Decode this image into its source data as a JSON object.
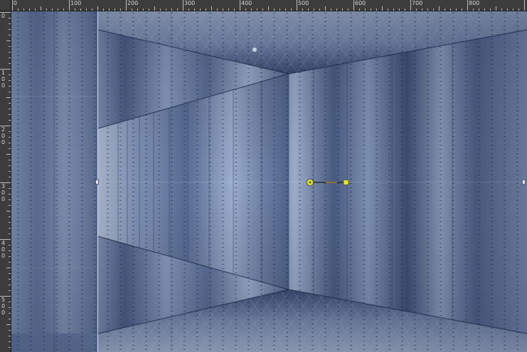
{
  "ruler": {
    "horizontal_labels": [
      "0",
      "100",
      "200",
      "300",
      "400",
      "500",
      "600",
      "700",
      "800"
    ],
    "vertical_labels": [
      "0",
      "100",
      "200",
      "300",
      "400",
      "500"
    ]
  },
  "colors": {
    "canvas_base": "#7e93b8",
    "canvas_dark": "#394b73",
    "canvas_light": "#b4c3dd",
    "ruler_bg": "#3c3c3c",
    "ruler_text": "#d6d6d6",
    "handle_yellow": "#e3ec1c"
  },
  "tool": {
    "icons": [
      "rotation-pivot-icon",
      "rotation-handle-icon",
      "guide-line-icon"
    ]
  }
}
